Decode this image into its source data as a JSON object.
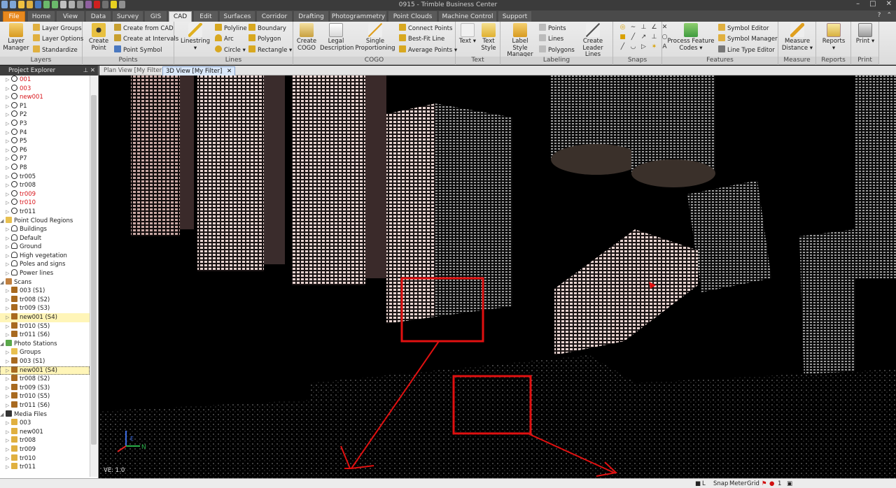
{
  "window": {
    "title": "0915 - Trimble Business Center"
  },
  "tabs": [
    "File",
    "Home",
    "View",
    "Data",
    "Survey",
    "GIS",
    "CAD",
    "Edit",
    "Surfaces",
    "Corridor",
    "Drafting",
    "Photogrammetry",
    "Point Clouds",
    "Machine Control",
    "Support"
  ],
  "active_tab": "CAD",
  "ribbon": {
    "groups": {
      "layers": "Layers",
      "points": "Points",
      "lines": "Lines",
      "cogo": "COGO",
      "text": "Text",
      "labeling": "Labeling",
      "snaps": "Snaps",
      "features": "Features",
      "measure": "Measure",
      "reports": "Reports",
      "print": "Print"
    },
    "buttons": {
      "layer_manager": "Layer Manager",
      "layer_groups": "Layer Groups",
      "layer_options": "Layer Options",
      "standardize": "Standardize",
      "create_point": "Create Point",
      "create_from_cad": "Create from CAD",
      "create_at_intervals": "Create at Intervals",
      "point_symbol": "Point Symbol",
      "linestring": "Linestring",
      "polyline": "Polyline",
      "arc": "Arc",
      "circle": "Circle",
      "boundary": "Boundary",
      "polygon": "Polygon",
      "rectangle": "Rectangle",
      "create_cogo": "Create COGO",
      "legal_description": "Legal Description",
      "single_proportioning": "Single Proportioning",
      "connect_points": "Connect Points",
      "best_fit_line": "Best-Fit Line",
      "average_points": "Average Points",
      "text": "Text",
      "text_style": "Text Style",
      "label_style_manager": "Label Style Manager",
      "lab_points": "Points",
      "lab_lines": "Lines",
      "lab_polygons": "Polygons",
      "create_leader_lines": "Create Leader Lines",
      "process_feature_codes": "Process Feature Codes",
      "symbol_editor": "Symbol Editor",
      "symbol_manager": "Symbol Manager",
      "line_type_editor": "Line Type Editor",
      "measure_distance": "Measure Distance",
      "reports": "Reports",
      "print": "Print"
    }
  },
  "project_explorer": {
    "title": "Project Explorer",
    "items": [
      {
        "label": "001",
        "icon": "point-icon",
        "red": true
      },
      {
        "label": "003",
        "icon": "point-icon",
        "red": true
      },
      {
        "label": "new001",
        "icon": "point-icon",
        "red": true
      },
      {
        "label": "P1",
        "icon": "point-icon"
      },
      {
        "label": "P2",
        "icon": "point-icon"
      },
      {
        "label": "P3",
        "icon": "point-icon"
      },
      {
        "label": "P4",
        "icon": "point-icon"
      },
      {
        "label": "P5",
        "icon": "point-icon"
      },
      {
        "label": "P6",
        "icon": "point-icon"
      },
      {
        "label": "P7",
        "icon": "point-icon"
      },
      {
        "label": "P8",
        "icon": "point-icon"
      },
      {
        "label": "tr005",
        "icon": "point-icon"
      },
      {
        "label": "tr008",
        "icon": "point-icon"
      },
      {
        "label": "tr009",
        "icon": "point-icon",
        "red": true
      },
      {
        "label": "tr010",
        "icon": "point-icon",
        "red": true
      },
      {
        "label": "tr011",
        "icon": "point-icon"
      },
      {
        "label": "Point Cloud Regions",
        "icon": "folder-icon",
        "group": true
      },
      {
        "label": "Buildings",
        "icon": "cloud-region-icon"
      },
      {
        "label": "Default",
        "icon": "cloud-region-icon"
      },
      {
        "label": "Ground",
        "icon": "cloud-region-icon"
      },
      {
        "label": "High vegetation",
        "icon": "cloud-region-icon"
      },
      {
        "label": "Poles and signs",
        "icon": "cloud-region-icon"
      },
      {
        "label": "Power lines",
        "icon": "cloud-region-icon"
      },
      {
        "label": "Scans",
        "icon": "scans-icon",
        "group": true
      },
      {
        "label": "003 (S1)",
        "icon": "scanner-icon"
      },
      {
        "label": "tr008 (S2)",
        "icon": "scanner-icon"
      },
      {
        "label": "tr009 (S3)",
        "icon": "scanner-icon"
      },
      {
        "label": "new001 (S4)",
        "icon": "scanner-icon",
        "highlight": true
      },
      {
        "label": "tr010 (S5)",
        "icon": "scanner-icon"
      },
      {
        "label": "tr011 (S6)",
        "icon": "scanner-icon"
      },
      {
        "label": "Photo Stations",
        "icon": "photo-station-icon",
        "group": true
      },
      {
        "label": "Groups",
        "icon": "folder-icon"
      },
      {
        "label": "003 (S1)",
        "icon": "scanner-icon"
      },
      {
        "label": "new001 (S4)",
        "icon": "scanner-icon",
        "selected": true
      },
      {
        "label": "tr008 (S2)",
        "icon": "scanner-icon"
      },
      {
        "label": "tr009 (S3)",
        "icon": "scanner-icon"
      },
      {
        "label": "tr010 (S5)",
        "icon": "scanner-icon"
      },
      {
        "label": "tr011 (S6)",
        "icon": "scanner-icon"
      },
      {
        "label": "Media Files",
        "icon": "media-icon",
        "group": true
      },
      {
        "label": "003",
        "icon": "media-folder-icon"
      },
      {
        "label": "new001",
        "icon": "media-folder-icon"
      },
      {
        "label": "tr008",
        "icon": "media-folder-icon"
      },
      {
        "label": "tr009",
        "icon": "media-folder-icon"
      },
      {
        "label": "tr010",
        "icon": "media-folder-icon"
      },
      {
        "label": "tr011",
        "icon": "media-folder-icon"
      }
    ]
  },
  "doc_tabs": [
    "Plan View [My Filter]",
    "3D View [My Filter]"
  ],
  "viewport": {
    "scale_label": "VE: 1.0",
    "axis_labels": {
      "x": "N",
      "y": "E"
    }
  },
  "status_bar": {
    "snap": "Snap",
    "units": "Meter",
    "grid": "Grid",
    "flag_count": "1"
  },
  "colors": {
    "file_tab": "#e8891e",
    "highlight_red": "#e01010",
    "selection": "#fff5b8"
  }
}
